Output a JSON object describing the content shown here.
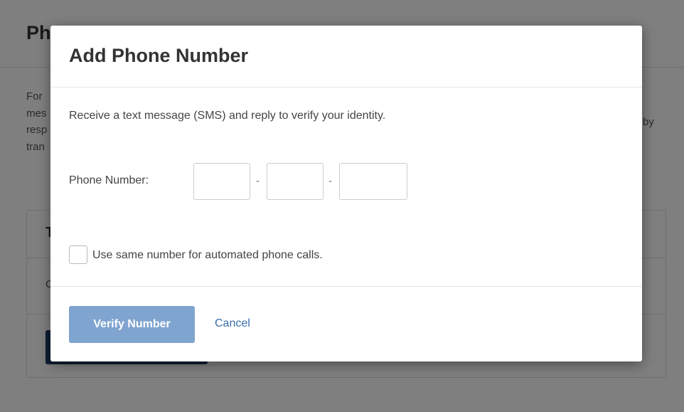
{
  "background": {
    "title": "Ph",
    "description_lines": [
      "For",
      "mes",
      "resp",
      "tran"
    ],
    "description_tail": "by",
    "card_header": "T",
    "card_row": "C"
  },
  "modal": {
    "title": "Add Phone Number",
    "description": "Receive a text message (SMS) and reply to verify your identity.",
    "phone_label": "Phone Number:",
    "phone_fields": {
      "area_code": "",
      "prefix": "",
      "line_number": ""
    },
    "separator": "-",
    "checkbox": {
      "label": "Use same number for automated phone calls.",
      "checked": false
    },
    "verify_button": "Verify Number",
    "cancel_link": "Cancel"
  },
  "colors": {
    "overlay": "rgba(0,0,0,0.5)",
    "verify_button_bg": "#7fa4cf",
    "link": "#3a6fa8",
    "background_button": "#1e3a66"
  }
}
